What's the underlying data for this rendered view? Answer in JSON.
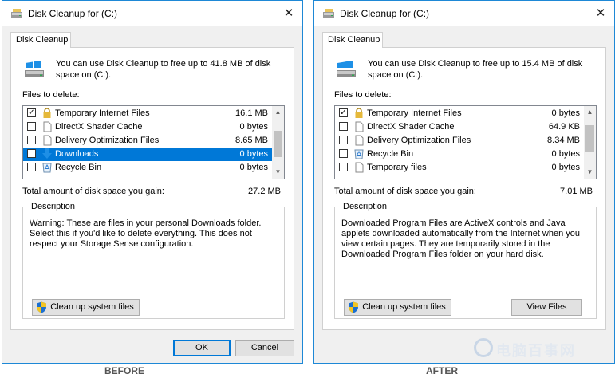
{
  "before": {
    "title": "Disk Cleanup for  (C:)",
    "tab": "Disk Cleanup",
    "intro": "You can use Disk Cleanup to free up to 41.8 MB of disk space on  (C:).",
    "files_label": "Files to delete:",
    "files": [
      {
        "name": "Temporary Internet Files",
        "size": "16.1 MB",
        "checked": true,
        "icon": "lock-icon"
      },
      {
        "name": "DirectX Shader Cache",
        "size": "0 bytes",
        "checked": false,
        "icon": "file-icon"
      },
      {
        "name": "Delivery Optimization Files",
        "size": "8.65 MB",
        "checked": false,
        "icon": "file-icon"
      },
      {
        "name": "Downloads",
        "size": "0 bytes",
        "checked": false,
        "icon": "download-arrow-icon",
        "selected": true
      },
      {
        "name": "Recycle Bin",
        "size": "0 bytes",
        "checked": false,
        "icon": "recycle-bin-icon"
      }
    ],
    "total_label": "Total amount of disk space you gain:",
    "total_value": "27.2 MB",
    "description_label": "Description",
    "description": "Warning: These are files in your personal Downloads folder. Select this if you'd like to delete everything. This does not respect your Storage Sense configuration.",
    "cleanup_button": "Clean up system files",
    "ok_button": "OK",
    "cancel_button": "Cancel",
    "caption": "BEFORE"
  },
  "after": {
    "title": "Disk Cleanup for  (C:)",
    "tab": "Disk Cleanup",
    "intro": "You can use Disk Cleanup to free up to 15.4 MB of disk space on  (C:).",
    "files_label": "Files to delete:",
    "files": [
      {
        "name": "Temporary Internet Files",
        "size": "0 bytes",
        "checked": true,
        "icon": "lock-icon"
      },
      {
        "name": "DirectX Shader Cache",
        "size": "64.9 KB",
        "checked": false,
        "icon": "file-icon"
      },
      {
        "name": "Delivery Optimization Files",
        "size": "8.34 MB",
        "checked": false,
        "icon": "file-icon"
      },
      {
        "name": "Recycle Bin",
        "size": "0 bytes",
        "checked": false,
        "icon": "recycle-bin-icon"
      },
      {
        "name": "Temporary files",
        "size": "0 bytes",
        "checked": false,
        "icon": "file-icon"
      }
    ],
    "total_label": "Total amount of disk space you gain:",
    "total_value": "7.01 MB",
    "description_label": "Description",
    "description": "Downloaded Program Files are ActiveX controls and Java applets downloaded automatically from the Internet when you view certain pages. They are temporarily stored in the Downloaded Program Files folder on your hard disk.",
    "cleanup_button": "Clean up system files",
    "view_button": "View Files",
    "caption": "AFTER"
  },
  "watermark": "电脑百事网",
  "colors": {
    "accent": "#0078d7",
    "window_border": "#1e88d6",
    "panel": "#f0f0f0"
  }
}
